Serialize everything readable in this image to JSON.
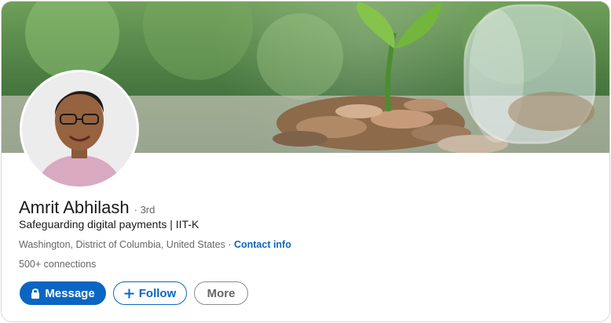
{
  "profile": {
    "name": "Amrit Abhilash",
    "degree": "· 3rd",
    "headline": "Safeguarding digital payments | IIT-K",
    "location": "Washington, District of Columbia, United States",
    "location_separator": " · ",
    "contact_info": "Contact info",
    "connections": "500+ connections"
  },
  "actions": {
    "message_label": "Message",
    "follow_label": "Follow",
    "more_label": "More"
  },
  "icons": {
    "message": "lock-icon",
    "follow": "plus-icon"
  },
  "colors": {
    "accent": "#0a66c2",
    "text_primary": "#191919",
    "text_secondary": "#666666"
  }
}
